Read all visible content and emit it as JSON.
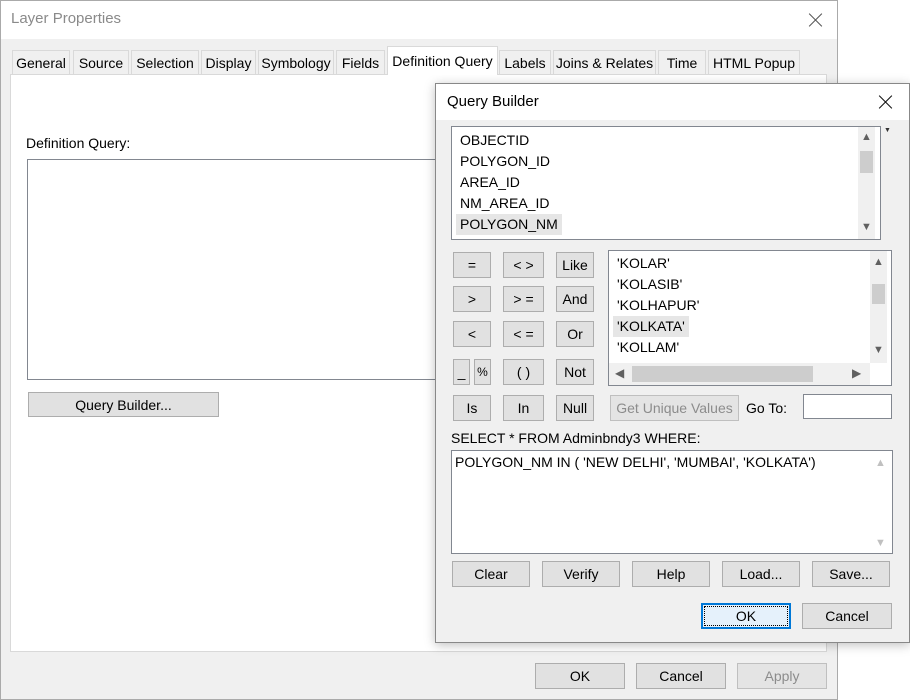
{
  "layer_properties": {
    "title": "Layer Properties",
    "tabs": [
      "General",
      "Source",
      "Selection",
      "Display",
      "Symbology",
      "Fields",
      "Definition Query",
      "Labels",
      "Joins & Relates",
      "Time",
      "HTML Popup"
    ],
    "definition_query_label": "Definition Query:",
    "query_builder_button": "Query Builder...",
    "ok": "OK",
    "cancel": "Cancel",
    "apply": "Apply"
  },
  "query_builder": {
    "title": "Query Builder",
    "fields": [
      "OBJECTID",
      "POLYGON_ID",
      "AREA_ID",
      "NM_AREA_ID",
      "POLYGON_NM"
    ],
    "selected_field": "POLYGON_NM",
    "operators": {
      "eq": "=",
      "ne": "< >",
      "like": "Like",
      "gt": ">",
      "ge": "> =",
      "and": "And",
      "lt": "<",
      "le": "< =",
      "or": "Or",
      "underscore": "_",
      "percent": "%",
      "parens": "( )",
      "not": "Not",
      "is": "Is",
      "in": "In",
      "null": "Null"
    },
    "values": [
      "'KOLAR'",
      "'KOLASIB'",
      "'KOLHAPUR'",
      "'KOLKATA'",
      "'KOLLAM'"
    ],
    "selected_value": "'KOLKATA'",
    "get_unique_values": "Get Unique Values",
    "goto_label": "Go To:",
    "goto_value": "",
    "select_statement": "SELECT * FROM Adminbndy3 WHERE:",
    "expression": "POLYGON_NM IN ( 'NEW DELHI', 'MUMBAI', 'KOLKATA')",
    "buttons": {
      "clear": "Clear",
      "verify": "Verify",
      "help": "Help",
      "load": "Load...",
      "save": "Save...",
      "ok": "OK",
      "cancel": "Cancel"
    }
  }
}
